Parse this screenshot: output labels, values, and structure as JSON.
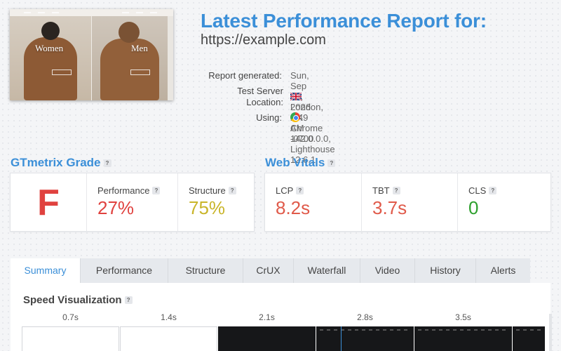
{
  "report": {
    "title": "Latest Performance Report for:",
    "url": "https://example.com",
    "meta": [
      {
        "label": "Report generated:",
        "value": "Sun, Sep 13, 2026 2:49 AM -0700"
      },
      {
        "label": "Test Server Location:",
        "value": "London, UK",
        "icon": "uk-flag-icon"
      },
      {
        "label": "Using:",
        "value": "Chrome 142.0.0.0, Lighthouse 12.6.1",
        "icon": "chrome-icon"
      }
    ]
  },
  "screenshot": {
    "left_label": "Women",
    "right_label": "Men"
  },
  "gtmetrix": {
    "heading": "GTmetrix Grade",
    "grade": "F",
    "performance_label": "Performance",
    "performance_value": "27%",
    "structure_label": "Structure",
    "structure_value": "75%"
  },
  "web_vitals": {
    "heading": "Web Vitals",
    "items": [
      {
        "label": "LCP",
        "value": "8.2s"
      },
      {
        "label": "TBT",
        "value": "3.7s"
      },
      {
        "label": "CLS",
        "value": "0"
      }
    ]
  },
  "colors": {
    "accent": "#3b8fd8",
    "bad": "#e0423f",
    "mid": "#c9b52a",
    "good": "#2ea02e",
    "warn": "#e05a4a"
  },
  "tabs": [
    "Summary",
    "Performance",
    "Structure",
    "CrUX",
    "Waterfall",
    "Video",
    "History",
    "Alerts"
  ],
  "active_tab": "Summary",
  "speed": {
    "heading": "Speed Visualization",
    "frames": [
      "0.7s",
      "1.4s",
      "2.1s",
      "2.8s",
      "3.5s"
    ]
  },
  "help_glyph": "?"
}
